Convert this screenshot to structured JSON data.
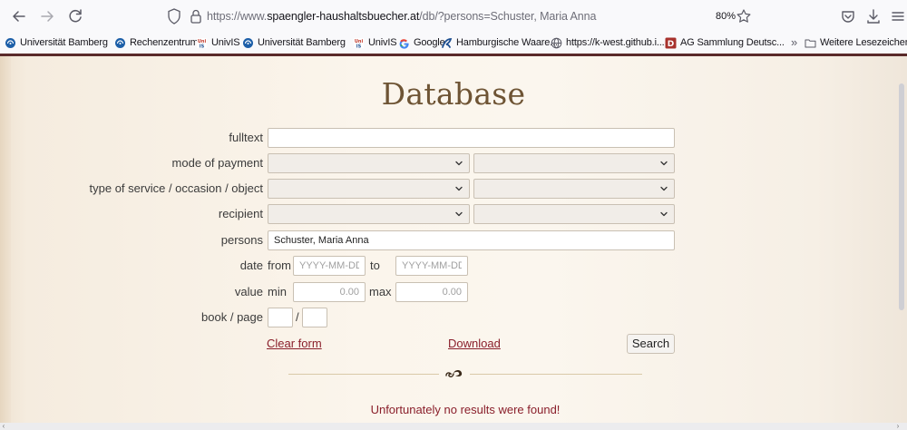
{
  "browser": {
    "url_prefix": "https://www.",
    "url_domain": "spaengler-haushaltsbuecher.at",
    "url_path": "/db/?persons=Schuster, Maria Anna",
    "zoom": "80%"
  },
  "bookmarks": [
    {
      "label": "Universität Bamberg",
      "icon": "uni-bamberg-icon"
    },
    {
      "label": "Rechenzentrum",
      "icon": "uni-bamberg-icon"
    },
    {
      "label": "UnivIS",
      "icon": "univis-icon"
    },
    {
      "label": "Universität Bamberg",
      "icon": "uni-bamberg-icon"
    },
    {
      "label": "UnivIS",
      "icon": "univis-icon"
    },
    {
      "label": "Google",
      "icon": "google-icon"
    },
    {
      "label": "Hamburgische Waare...",
      "icon": "hamburg-icon"
    },
    {
      "label": "https://k-west.github.i...",
      "icon": "globe-icon"
    },
    {
      "label": "AG Sammlung Deutsc...",
      "icon": "ag-sammlung-icon"
    }
  ],
  "bookmarks_more": "»",
  "bookmarks_folder": "Weitere Lesezeichen",
  "page": {
    "title": "Database",
    "fields": {
      "fulltext_label": "fulltext",
      "fulltext_value": "",
      "payment_label": "mode of payment",
      "service_label": "type of service / occasion / object",
      "recipient_label": "recipient",
      "persons_label": "persons",
      "persons_value": "Schuster, Maria Anna",
      "date_label": "date",
      "date_from": "from",
      "date_to": "to",
      "date_placeholder": "YYYY-MM-DD",
      "value_label": "value",
      "value_min": "min",
      "value_max": "max",
      "value_placeholder": "0.00",
      "book_label": "book / page",
      "book_sep": "/"
    },
    "clear_label": "Clear form",
    "download_label": "Download",
    "search_label": "Search",
    "no_results": "Unfortunately no results were found!"
  },
  "colors": {
    "accent_line": "#5a2a2a",
    "title": "#6e5434",
    "link": "#8a1f2b"
  }
}
